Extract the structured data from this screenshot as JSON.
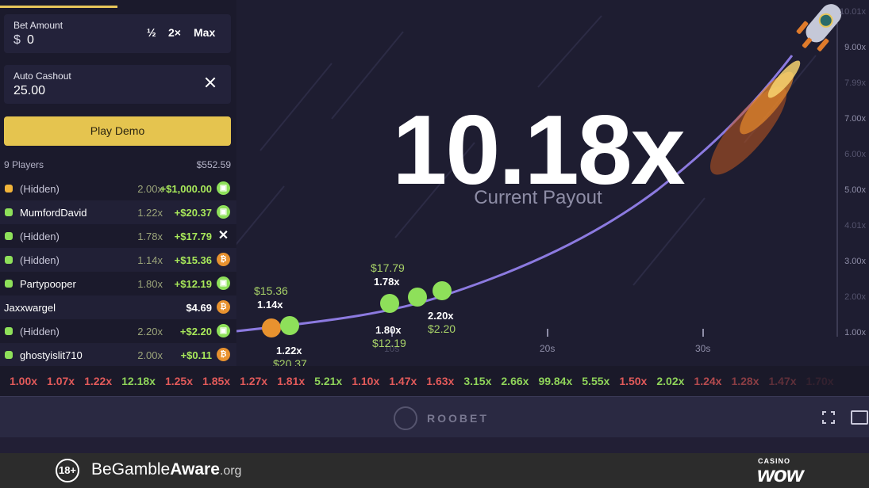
{
  "bet": {
    "label": "Bet Amount",
    "currency": "$",
    "value": "0",
    "half_label": "½",
    "double_label": "2×",
    "max_label": "Max"
  },
  "auto_cashout": {
    "label": "Auto Cashout",
    "value": "25.00"
  },
  "play_button": "Play Demo",
  "players": {
    "count_label": "9 Players",
    "total": "$552.59",
    "rows": [
      {
        "name": "(Hidden)",
        "mult": "2.00x",
        "profit": "+$1,000.00",
        "icon": "ticket-icon"
      },
      {
        "name": "MumfordDavid",
        "mult": "1.22x",
        "profit": "+$20.37",
        "icon": "ticket-icon"
      },
      {
        "name": "(Hidden)",
        "mult": "1.78x",
        "profit": "+$17.79",
        "icon": "x-icon"
      },
      {
        "name": "(Hidden)",
        "mult": "1.14x",
        "profit": "+$15.36",
        "icon": "bitcoin-icon"
      },
      {
        "name": "Partypooper",
        "mult": "1.80x",
        "profit": "+$12.19",
        "icon": "ticket-icon"
      },
      {
        "name": "Jaxxwargel",
        "mult": "",
        "profit": "$4.69",
        "icon": "bitcoin-icon"
      },
      {
        "name": "(Hidden)",
        "mult": "2.20x",
        "profit": "+$2.20",
        "icon": "ticket-icon"
      },
      {
        "name": "ghostyislit710",
        "mult": "2.00x",
        "profit": "+$0.11",
        "icon": "bitcoin-icon"
      }
    ]
  },
  "game": {
    "current_multiplier": "10.18x",
    "payout_label": "Current Payout",
    "y_axis": [
      "10.01x",
      "9.00x",
      "7.99x",
      "7.00x",
      "6.00x",
      "5.00x",
      "4.01x",
      "3.00x",
      "2.00x",
      "1.00x"
    ],
    "x_axis": [
      "10s",
      "20s",
      "30s"
    ],
    "cashouts": [
      {
        "amount": "$15.36",
        "mult": "1.14x"
      },
      {
        "mult": "1.22x",
        "amount": "$20.37"
      },
      {
        "amount": "$17.79",
        "mult": "1.78x"
      },
      {
        "mult": "1.80x",
        "amount": "$12.19"
      },
      {
        "mult": "2.20x",
        "amount": "$2.20"
      }
    ],
    "colors": {
      "curve": "#8c7ae0",
      "accent": "#e5c44f",
      "win": "#8ee05a"
    }
  },
  "history": [
    {
      "v": "1.00x",
      "c": "red"
    },
    {
      "v": "1.07x",
      "c": "red"
    },
    {
      "v": "1.22x",
      "c": "red"
    },
    {
      "v": "12.18x",
      "c": "green"
    },
    {
      "v": "1.25x",
      "c": "red"
    },
    {
      "v": "1.85x",
      "c": "red"
    },
    {
      "v": "1.27x",
      "c": "red"
    },
    {
      "v": "1.81x",
      "c": "red"
    },
    {
      "v": "5.21x",
      "c": "green"
    },
    {
      "v": "1.10x",
      "c": "red"
    },
    {
      "v": "1.47x",
      "c": "red"
    },
    {
      "v": "1.63x",
      "c": "red"
    },
    {
      "v": "3.15x",
      "c": "green"
    },
    {
      "v": "2.66x",
      "c": "green"
    },
    {
      "v": "99.84x",
      "c": "green"
    },
    {
      "v": "5.55x",
      "c": "green"
    },
    {
      "v": "1.50x",
      "c": "red"
    },
    {
      "v": "2.02x",
      "c": "green"
    },
    {
      "v": "1.24x",
      "c": "red"
    },
    {
      "v": "1.28x",
      "c": "red"
    },
    {
      "v": "1.47x",
      "c": "red"
    },
    {
      "v": "1.70x",
      "c": "red"
    }
  ],
  "brand": "ROOBET",
  "footer": {
    "age": "18+",
    "aware_pre": "Be",
    "aware_mid": "Gamble",
    "aware_bold": "Aware",
    "aware_dom": ".org",
    "casino_small": "CASINO",
    "casino_big": "wow"
  }
}
